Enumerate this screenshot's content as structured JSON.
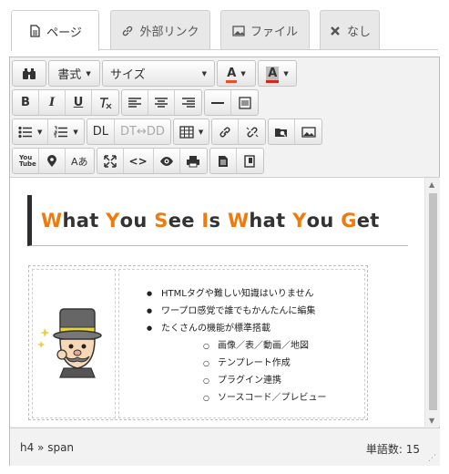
{
  "tabs": [
    {
      "label": "ページ",
      "icon": "document-icon",
      "active": true
    },
    {
      "label": "外部リンク",
      "icon": "link-icon",
      "active": false
    },
    {
      "label": "ファイル",
      "icon": "image-icon",
      "active": false
    },
    {
      "label": "なし",
      "icon": "close-icon",
      "active": false
    }
  ],
  "toolbar": {
    "format_label": "書式",
    "size_label": "サイズ",
    "font_color_label": "A",
    "bg_color_label": "A",
    "bold_label": "B",
    "italic_label": "I",
    "underline_label": "U",
    "clear_format_label": "Tx",
    "dl_label": "DL",
    "dt_dd_label": "DT↔DD",
    "youtube_label": "You Tube",
    "kana_label": "Aあ",
    "code_label": "<>",
    "accent_color": "#f07a0c",
    "font_color_bar": "#e8502a",
    "bg_color_bar": "#d9261c"
  },
  "content": {
    "heading_parts": [
      {
        "text": "W",
        "accent": true
      },
      {
        "text": "hat ",
        "accent": false
      },
      {
        "text": "Y",
        "accent": true
      },
      {
        "text": "ou ",
        "accent": false
      },
      {
        "text": "S",
        "accent": true
      },
      {
        "text": "ee ",
        "accent": false
      },
      {
        "text": "I",
        "accent": true
      },
      {
        "text": "s ",
        "accent": false
      },
      {
        "text": "W",
        "accent": true
      },
      {
        "text": "hat ",
        "accent": false
      },
      {
        "text": "Y",
        "accent": true
      },
      {
        "text": "ou ",
        "accent": false
      },
      {
        "text": "G",
        "accent": true
      },
      {
        "text": "et",
        "accent": false
      }
    ],
    "features": [
      "HTMLタグや難しい知識はいりません",
      "ワープロ感覚で誰でもかんたんに編集",
      "たくさんの機能が標準搭載"
    ],
    "sub_features": [
      "画像／表／動画／地図",
      "テンプレート作成",
      "プラグイン連携",
      "ソースコード／プレビュー"
    ]
  },
  "status": {
    "path": "h4 » span",
    "word_count": "単語数: 15"
  }
}
